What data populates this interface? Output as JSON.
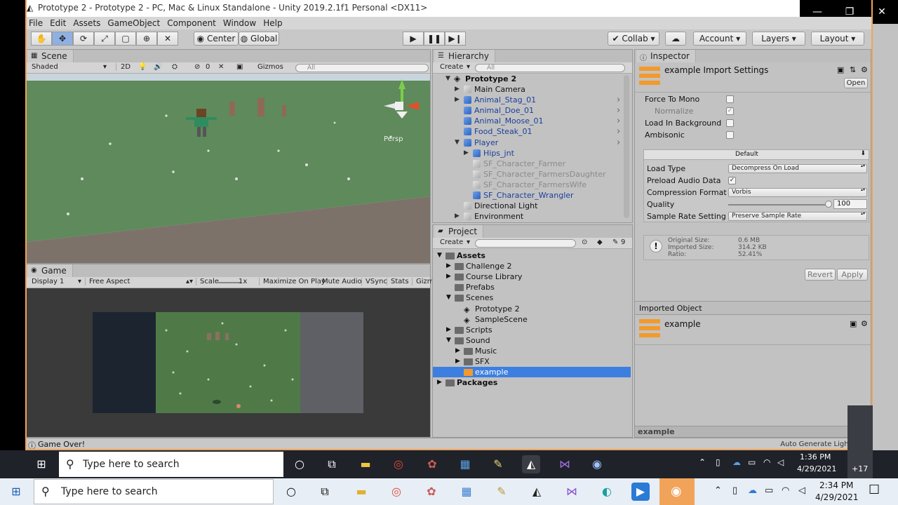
{
  "window": {
    "title": "Prototype 2 - Prototype 2 - PC, Mac & Linux Standalone - Unity 2019.2.1f1 Personal <DX11>",
    "controls": [
      "—",
      "❐",
      "✕"
    ]
  },
  "menu": [
    "File",
    "Edit",
    "Assets",
    "GameObject",
    "Component",
    "Window",
    "Help"
  ],
  "toolbar": {
    "center": "Center",
    "global": "Global",
    "collab": "Collab",
    "account": "Account",
    "layers": "Layers",
    "layout": "Layout"
  },
  "scene": {
    "tab": "Scene",
    "shading": "Shaded",
    "mode2d": "2D",
    "fx_count": "0",
    "gizmos": "Gizmos",
    "search_placeholder": "All",
    "persp": "Persp"
  },
  "game": {
    "tab": "Game",
    "display": "Display 1",
    "aspect": "Free Aspect",
    "scale_label": "Scale",
    "scale_value": "1x",
    "maximize": "Maximize On Play",
    "mute": "Mute Audio",
    "vsync": "VSync",
    "stats": "Stats",
    "gizmos": "Gizm"
  },
  "hierarchy": {
    "tab": "Hierarchy",
    "create": "Create",
    "search_placeholder": "All",
    "scene_name": "Prototype 2",
    "items": [
      {
        "label": "Main Camera",
        "style": "normal",
        "indent": 0
      },
      {
        "label": "Animal_Stag_01",
        "style": "blue",
        "indent": 0
      },
      {
        "label": "Animal_Doe_01",
        "style": "blue",
        "indent": 0
      },
      {
        "label": "Animal_Moose_01",
        "style": "blue",
        "indent": 0
      },
      {
        "label": "Food_Steak_01",
        "style": "blue",
        "indent": 0
      },
      {
        "label": "Player",
        "style": "blue",
        "indent": 0
      },
      {
        "label": "Hips_jnt",
        "style": "blue",
        "indent": 1
      },
      {
        "label": "SF_Character_Farmer",
        "style": "grey",
        "indent": 1
      },
      {
        "label": "SF_Character_FarmersDaughter",
        "style": "grey",
        "indent": 1
      },
      {
        "label": "SF_Character_FarmersWife",
        "style": "grey",
        "indent": 1
      },
      {
        "label": "SF_Character_Wrangler",
        "style": "blue",
        "indent": 1
      },
      {
        "label": "Directional Light",
        "style": "normal",
        "indent": 0
      },
      {
        "label": "Environment",
        "style": "normal",
        "indent": 0
      }
    ]
  },
  "project": {
    "tab": "Project",
    "create": "Create",
    "hidden_count": "9",
    "items": [
      {
        "label": "Assets",
        "type": "root"
      },
      {
        "label": "Challenge 2",
        "type": "folder",
        "indent": 1
      },
      {
        "label": "Course Library",
        "type": "folder",
        "indent": 1
      },
      {
        "label": "Prefabs",
        "type": "folder",
        "indent": 1
      },
      {
        "label": "Scenes",
        "type": "folder",
        "indent": 1
      },
      {
        "label": "Prototype 2",
        "type": "scene",
        "indent": 2
      },
      {
        "label": "SampleScene",
        "type": "scene",
        "indent": 2
      },
      {
        "label": "Scripts",
        "type": "folder",
        "indent": 1
      },
      {
        "label": "Sound",
        "type": "folder",
        "indent": 1
      },
      {
        "label": "Music",
        "type": "folder",
        "indent": 2
      },
      {
        "label": "SFX",
        "type": "folder",
        "indent": 2
      },
      {
        "label": "example",
        "type": "audio",
        "indent": 2
      },
      {
        "label": "Packages",
        "type": "root"
      }
    ]
  },
  "inspector": {
    "tab": "Inspector",
    "header": "example Import Settings",
    "open": "Open",
    "force_mono": "Force To Mono",
    "normalize": "Normalize",
    "load_bg": "Load In Background",
    "ambisonic": "Ambisonic",
    "platform": "Default",
    "load_type_label": "Load Type",
    "load_type": "Decompress On Load",
    "preload_label": "Preload Audio Data",
    "compression_label": "Compression Format",
    "compression": "Vorbis",
    "quality_label": "Quality",
    "quality": "100",
    "sample_rate_label": "Sample Rate Setting",
    "sample_rate": "Preserve Sample Rate",
    "original_size_label": "Original Size:",
    "original_size": "0.6 MB",
    "imported_size_label": "Imported Size:",
    "imported_size": "314.2 KB",
    "ratio_label": "Ratio:",
    "ratio": "52.41%",
    "revert": "Revert",
    "apply": "Apply",
    "imported_object": "Imported Object",
    "object_name": "example",
    "preview_name": "example"
  },
  "status": {
    "message": "Game Over!",
    "right": "Auto Generate Lighting O"
  },
  "inner_taskbar": {
    "search": "Type here to search",
    "time": "1:36 PM",
    "date": "4/29/2021",
    "badge": "+17"
  },
  "outer_taskbar": {
    "search": "Type here to search",
    "time": "2:34 PM",
    "date": "4/29/2021"
  },
  "colors": {
    "accent_orange": "#f2a35a",
    "selection": "#3d7fe0",
    "taskbar_dark": "#1f1f1f"
  }
}
